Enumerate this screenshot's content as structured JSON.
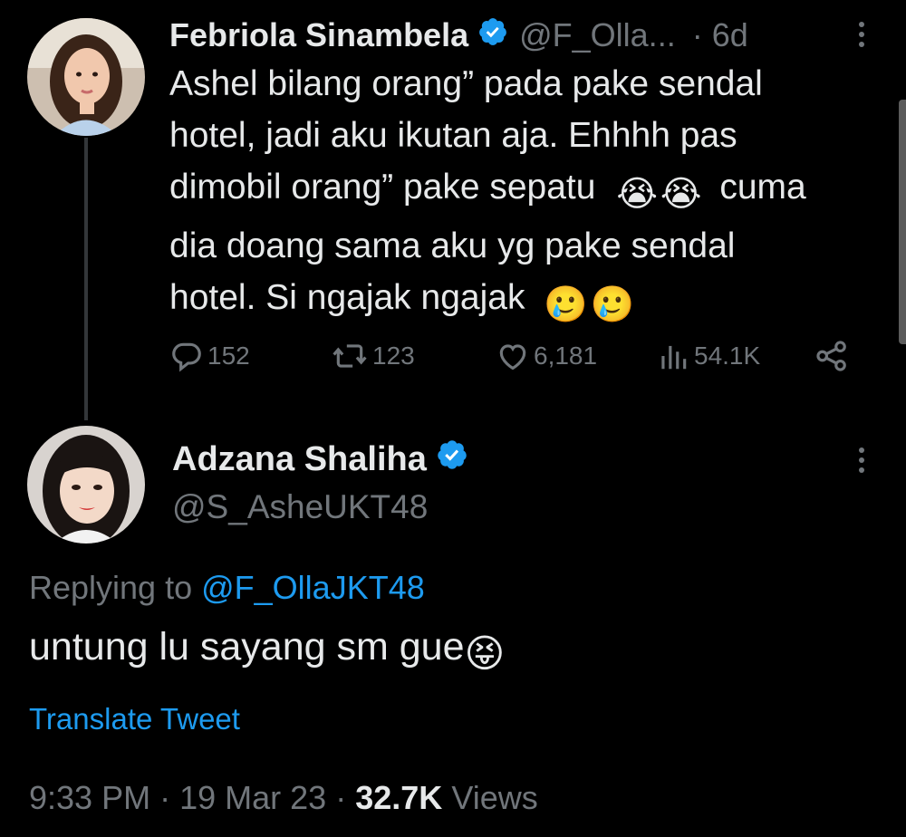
{
  "colors": {
    "background": "#000000",
    "text_primary": "#e7e9ea",
    "text_muted": "#71767b",
    "link": "#1d9bf0",
    "verified_badge": "#1d9bf0"
  },
  "parent_tweet": {
    "author_name": "Febriola Sinambela",
    "verified_icon": "verified-badge-icon",
    "handle": "@F_Olla...",
    "time": "· 6d",
    "text_line_1": "Ashel bilang orang” pada pake sendal",
    "text_line_2": "hotel, jadi aku ikutan aja. Ehhhh pas",
    "text_line_3_a": "dimobil orang” pake sepatu",
    "text_line_3_b": "cuma",
    "text_line_4": "dia doang sama aku yg pake sendal",
    "text_line_5": "hotel. Si ngajak ngajak",
    "emoji_crying": "😭",
    "emoji_tear_smile": "🥲",
    "actions": {
      "replies": "152",
      "retweets": "123",
      "likes": "6,181",
      "views": "54.1K"
    }
  },
  "reply_tweet": {
    "author_name": "Adzana Shaliha",
    "verified_icon": "verified-badge-icon",
    "handle": "@S_AsheUKT48",
    "replying_to_label": "Replying to",
    "replying_to_handle": "@F_OllaJKT48",
    "text": "untung lu sayang sm gue",
    "emoji_tongue": "😝",
    "translate_label": "Translate Tweet",
    "time": "9:33 PM",
    "date": "19 Mar 23",
    "views_count": "32.7K",
    "views_label": "Views"
  }
}
